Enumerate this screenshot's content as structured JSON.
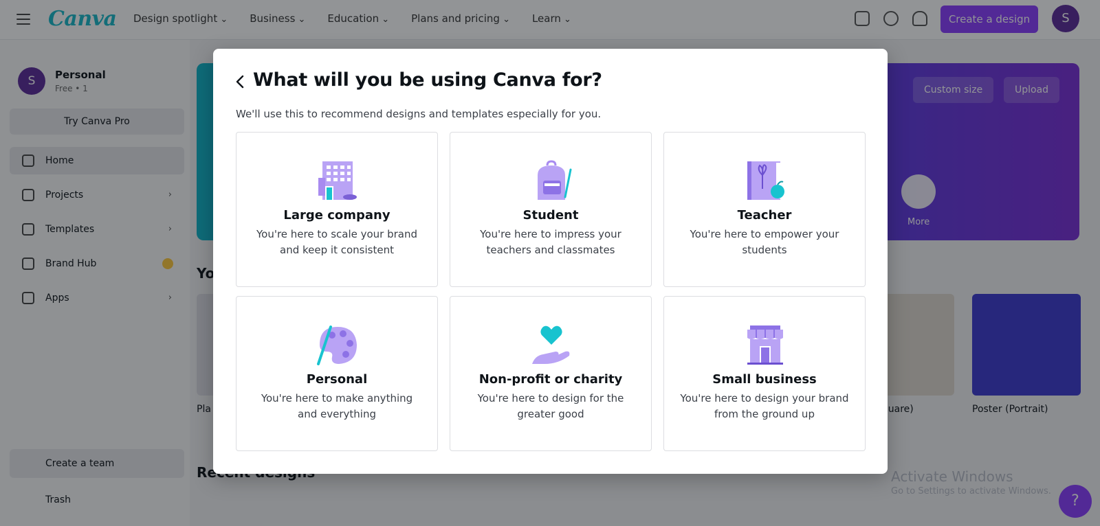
{
  "app": {
    "logo_text": "Canva",
    "nav": [
      "Design spotlight",
      "Business",
      "Education",
      "Plans and pricing",
      "Learn"
    ],
    "create_button": "Create a design",
    "user_initial": "S",
    "account": {
      "name": "Personal",
      "sub": "Free • 1"
    },
    "try_pro": "Try Canva Pro",
    "sidebar_items": [
      {
        "label": "Home"
      },
      {
        "label": "Projects"
      },
      {
        "label": "Templates"
      },
      {
        "label": "Brand Hub"
      },
      {
        "label": "Apps"
      }
    ],
    "create_team": "Create a team",
    "trash": "Trash",
    "hero_buttons": [
      "Custom size",
      "Upload"
    ],
    "hero_more": "More",
    "section_title": "Yo",
    "thumb_labels": [
      "Pla",
      "Square)",
      "Poster (Portrait)"
    ],
    "recent_title": "Recent designs",
    "activate_line1": "Activate Windows",
    "activate_line2": "Go to Settings to activate Windows."
  },
  "colors": {
    "accent": "#8b3dff",
    "illustration_primary": "#a88bf0",
    "illustration_teal": "#18c3cf"
  },
  "modal": {
    "back_icon": "chevron-left-icon",
    "title": "What will you be using Canva for?",
    "subtitle": "We'll use this to recommend designs and templates especially for you.",
    "options": [
      {
        "icon": "office-building-icon",
        "title": "Large company",
        "description": "You're here to scale your brand and keep it consistent"
      },
      {
        "icon": "backpack-icon",
        "title": "Student",
        "description": "You're here to impress your teachers and classmates"
      },
      {
        "icon": "book-apple-icon",
        "title": "Teacher",
        "description": "You're here to empower your students"
      },
      {
        "icon": "paint-palette-icon",
        "title": "Personal",
        "description": "You're here to make anything and everything"
      },
      {
        "icon": "heart-hand-icon",
        "title": "Non-profit or charity",
        "description": "You're here to design for the greater good"
      },
      {
        "icon": "storefront-icon",
        "title": "Small business",
        "description": "You're here to design your brand from the ground up"
      }
    ]
  }
}
